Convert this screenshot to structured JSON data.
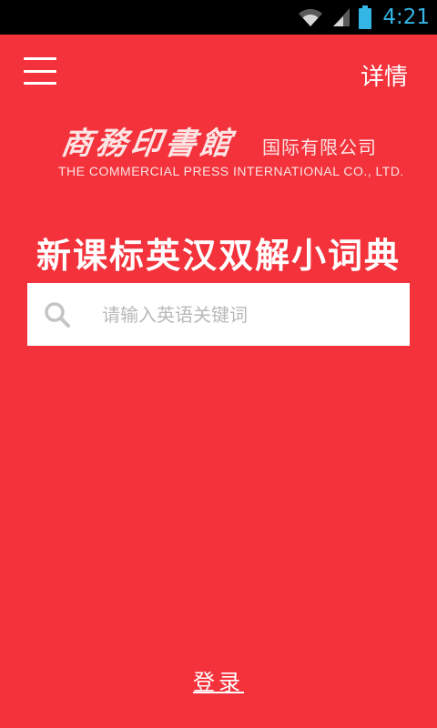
{
  "status_bar": {
    "time": "4:21",
    "icons": [
      "wifi-icon",
      "signal-icon",
      "battery-icon"
    ],
    "time_color": "#33b5e5"
  },
  "app_bar": {
    "menu_icon": "hamburger-menu-icon",
    "details_label": "详情"
  },
  "logo": {
    "calligraphy": "商務印書館",
    "chinese_name": "国际有限公司",
    "english_name": "THE  COMMERCIAL  PRESS   INTERNATIONAL  CO.,  LTD."
  },
  "main": {
    "title": "新课标英汉双解小词典",
    "search": {
      "icon": "search-icon",
      "placeholder": "请输入英语关键词",
      "value": ""
    }
  },
  "footer": {
    "login_label": "登录"
  },
  "colors": {
    "background": "#f3323b",
    "status_bar": "#000000",
    "search_bg": "#ffffff",
    "placeholder": "#b8b8b8"
  }
}
